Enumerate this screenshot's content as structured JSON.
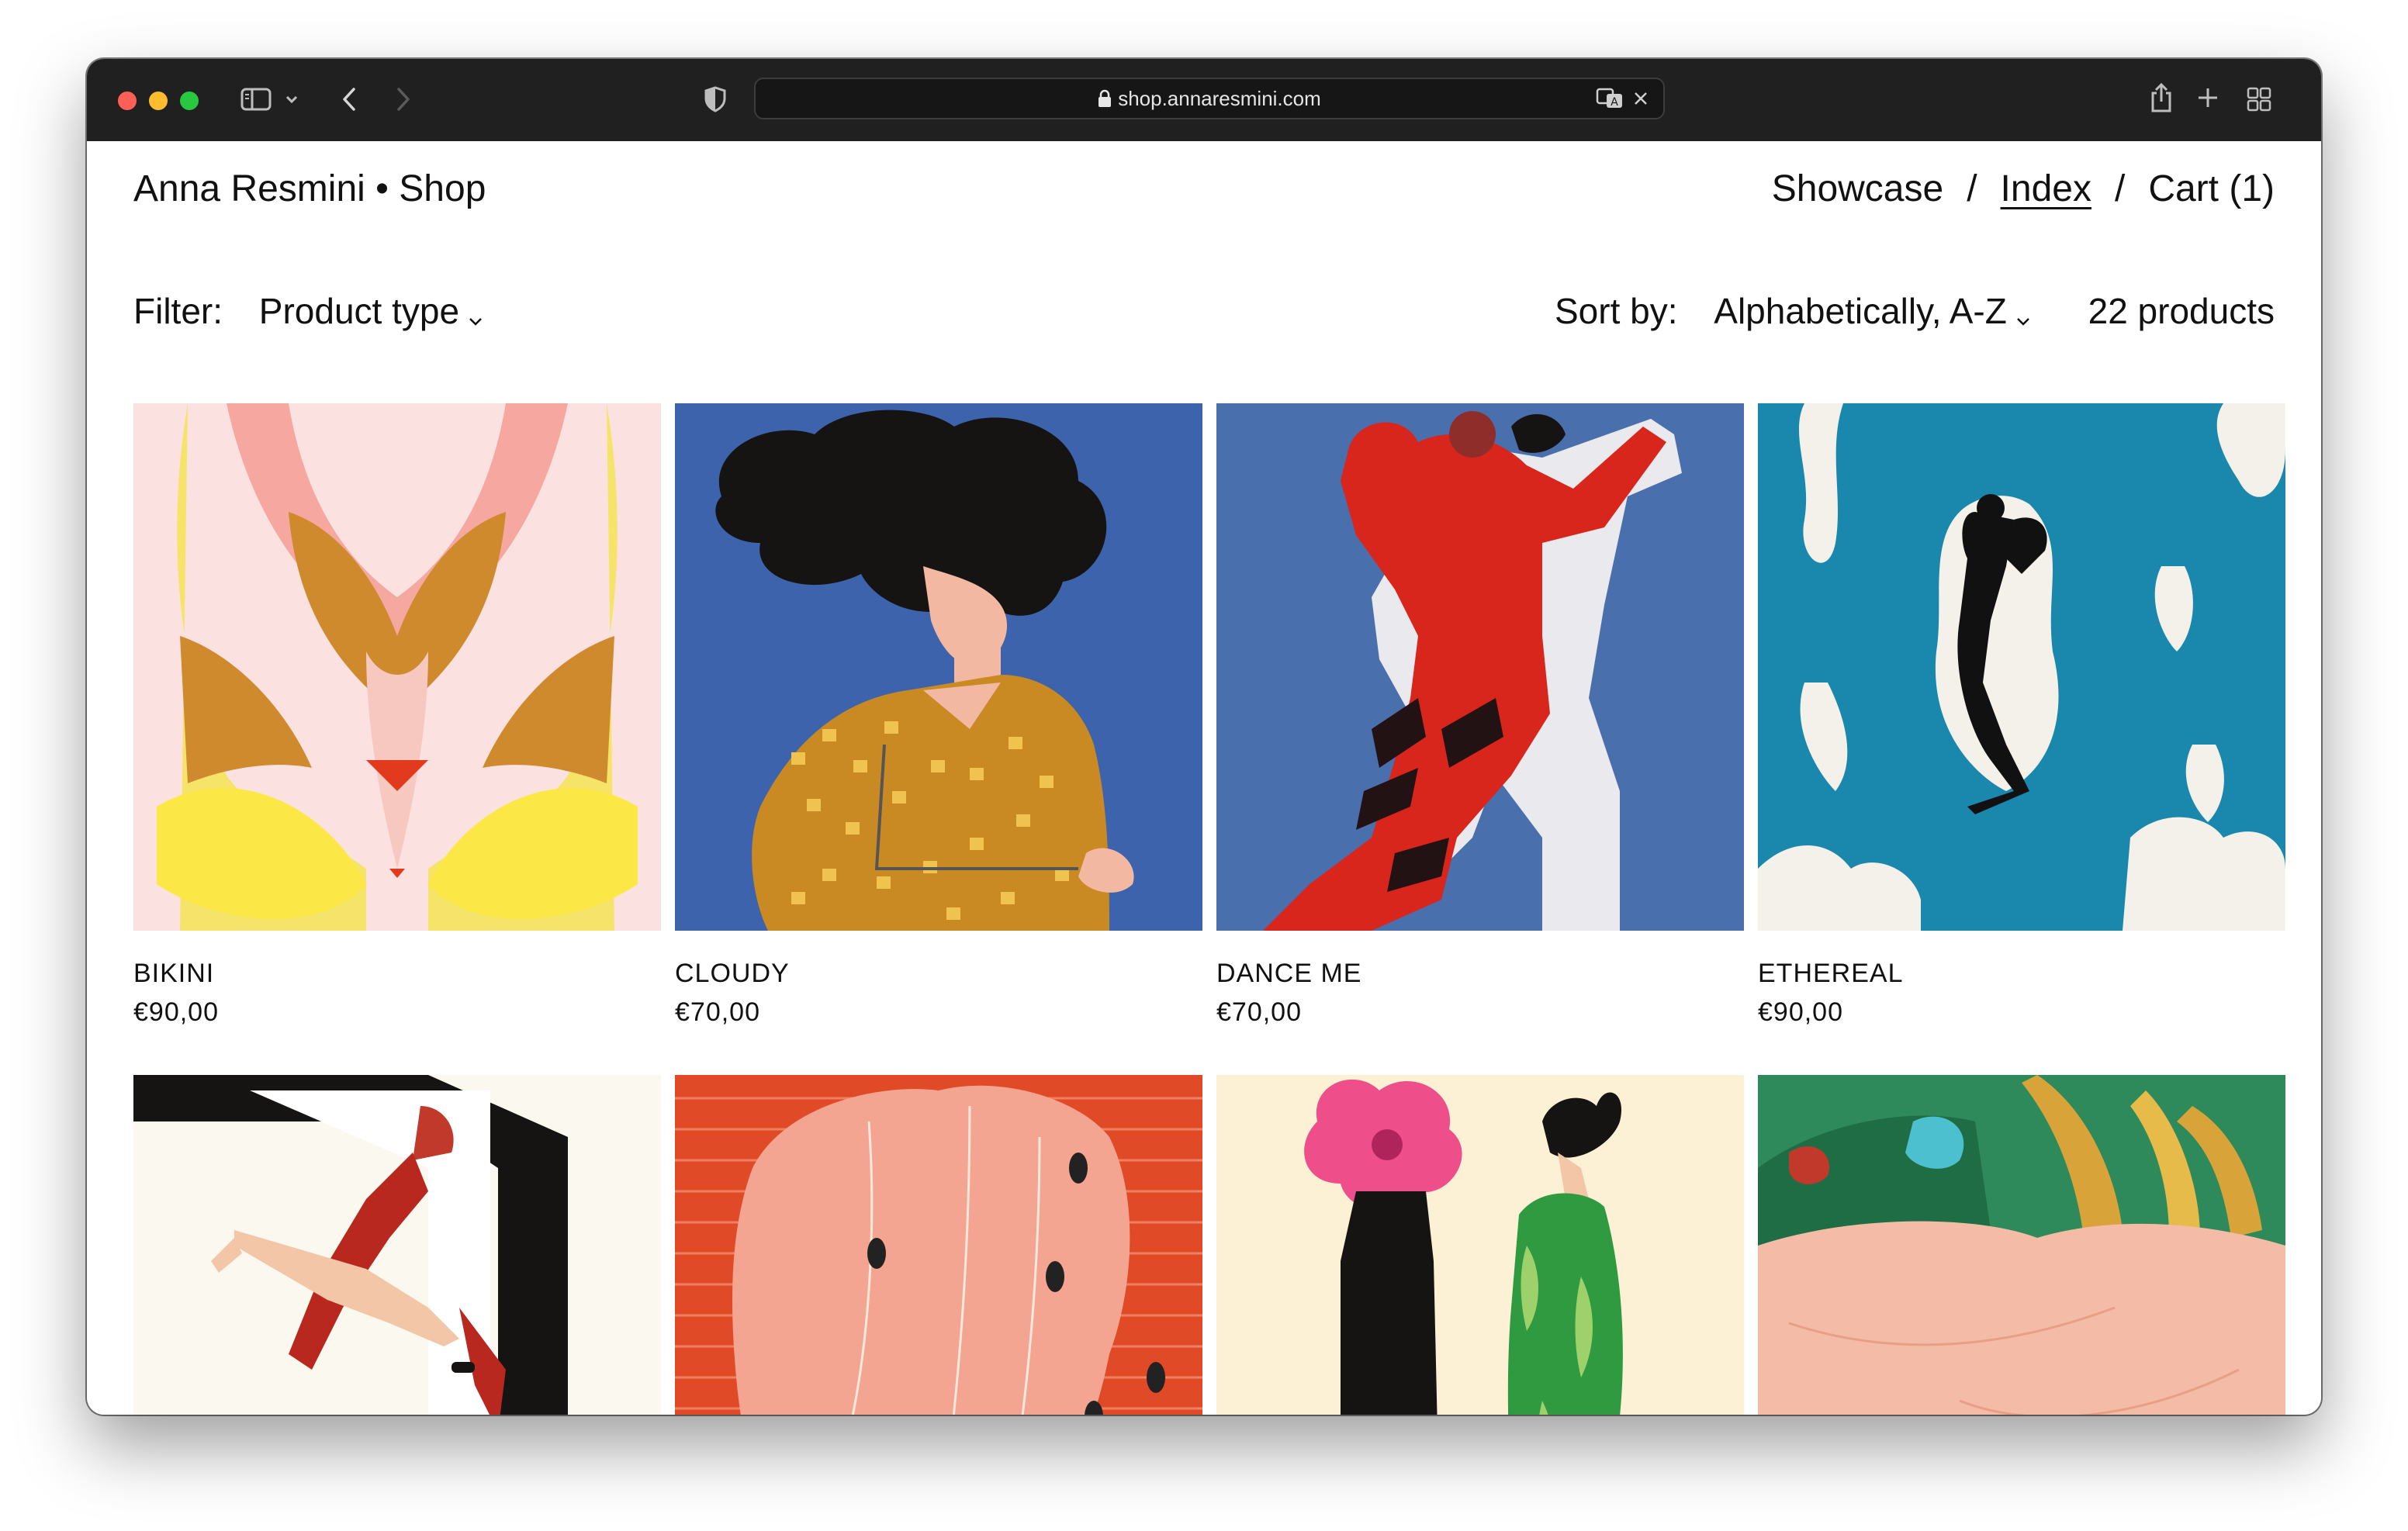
{
  "browser": {
    "url": "shop.annaresmini.com"
  },
  "header": {
    "brand": "Anna Resmini • Shop",
    "nav": [
      {
        "label": "Showcase"
      },
      {
        "label": "Index"
      },
      {
        "label": "Cart (1)"
      }
    ],
    "separator": "/"
  },
  "filter": {
    "label": "Filter:",
    "value": "Product type"
  },
  "sort": {
    "label": "Sort by:",
    "value": "Alphabetically, A-Z",
    "count": "22 products"
  },
  "products": [
    {
      "title": "BIKINI",
      "price": "€90,00"
    },
    {
      "title": "CLOUDY",
      "price": "€70,00"
    },
    {
      "title": "DANCE ME",
      "price": "€70,00"
    },
    {
      "title": "ETHEREAL",
      "price": "€90,00"
    }
  ],
  "icons": {
    "close": "close-icon",
    "lock": "lock-icon",
    "translate": "translate-icon",
    "shield": "shield-icon",
    "sidebar": "sidebar-icon",
    "share": "share-icon",
    "new_tab": "plus-icon",
    "tabs": "tab-overview-icon"
  },
  "colors": {
    "traffic_red": "#fe5f57",
    "traffic_yellow": "#febc2e",
    "traffic_green": "#28c840",
    "toolbar": "#202020"
  }
}
